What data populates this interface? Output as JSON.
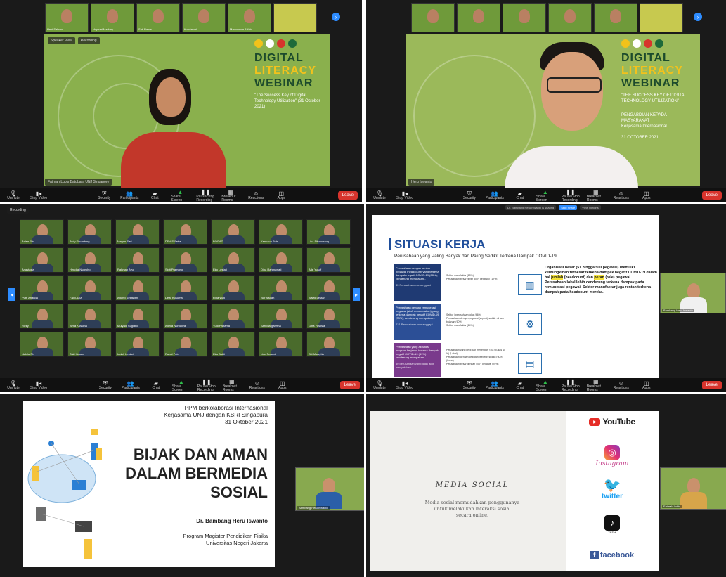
{
  "panel1": {
    "thumbs": [
      "Heni Sabrina",
      "Hapsari Maduny",
      "Sati Ratna",
      "Kurniawati",
      "Mamoonda Alifah"
    ],
    "chip_left": "Speaker View",
    "chip_right": "Recording",
    "slide": {
      "title_1": "DIGITAL",
      "title_2": "LITERACY",
      "title_3": "WEBINAR",
      "tagline": "\"The Success Key of Digital Technology Utilization\" (31 October 2021)"
    },
    "speaker_name": "Fatmah Lubis Batubara UNJ Singapore"
  },
  "panel2": {
    "slide": {
      "title_1": "DIGITAL",
      "title_2": "LITERACY",
      "title_3": "WEBINAR",
      "tagline": "\"THE SUCCESS KEY OF DIGITAL TECHNOLOGY UTILIZATION\"",
      "extra_1": "PENGABDIAN KEPADA MASYARAKAT",
      "extra_2": "Kerjasama Internasional",
      "date": "31 OCTOBER 2021"
    },
    "speaker_name": "Heru Iswanto"
  },
  "toolbar": {
    "mute": "Unmute",
    "video": "Stop Video",
    "security": "Security",
    "participants": "Participants",
    "chat": "Chat",
    "share": "Share Screen",
    "record": "Pause/Stop Recording",
    "breakout": "Breakout Rooms",
    "reactions": "Reactions",
    "apps": "Apps",
    "end": "Leave"
  },
  "panel3": {
    "chip": "Recording",
    "participants": [
      "Anisa Fitri",
      "Jody Sihombing",
      "Megan Sari",
      "DEVIS Setia",
      "BOGAZI",
      "Kencana Putri",
      "Lisa Situmorang",
      "Anastasia",
      "Hendra Nugroho",
      "Rahmah Ayu",
      "Sigit Pramono",
      "Eko Lestari",
      "Dina Rahmawati",
      "Ade Yusuf",
      "Putri Ananda",
      "Fadli Aziz",
      "Agung Setiawan",
      "Dewi Kusuma",
      "Rina Wati",
      "Nur Aisyah",
      "Wiwik Lestari",
      "Rizky",
      "Bima Kusuma",
      "Mulyadi Sugiarto",
      "Adelia Nurhaliza",
      "Yudi Pratama",
      "Sari Margaretha",
      "Gina Yustisia",
      "Nabila Ph",
      "Zaki Hasan",
      "Indah Lestari",
      "Rahul Putri",
      "Eka Sakti",
      "Lina Fenardi",
      "Siti Marsyita"
    ]
  },
  "panel4": {
    "meeting_bar": "Dr. Bambang Heru Iswanto is sharing",
    "stop_share": "Stop Share",
    "more": "View Options",
    "slide": {
      "title": "SITUASI KERJA",
      "subtitle": "Perusahaan yang Paling Banyak dan Paling Sedikit Terkena Dampak COVID-19",
      "box_1": "Perusahaan dengan jumlah pegawai (headcount) yang terkena dampak negatif COVID-19 (68%), cenderung merupakan...",
      "box_1_note": "45 Perusahaan menanggapi",
      "box_2": "Perusahaan dengan remunerasi pegawai (staff remuneration) yang terkena dampak negatif COVID-19 (33%), cenderung merupakan...",
      "box_2_note": "231 Perusahaan menanggapi",
      "box_3": "Perusahaan yang aktivitas program kerjanya terkena dampak negatif COVID-19 (59%) cenderung merupakan...",
      "box_3_note": "40 perusahaan yang tidak aktif menyatakan",
      "list_1": [
        "Sektor manufaktur (18%)",
        "Perusahaan besar (lebih 500+ pegawai) (12%)"
      ],
      "list_2": [
        "Sektor / perusahaan lokal (66%)",
        "Perusahaan dengan pegawai (seperti) sedikit <1 jam bulanan (60%)",
        "Sektor manufaktur (14%)"
      ],
      "list_3": [
        "Perusahaan yang kecil dan menengah <50 (di atas 10 %) (Lokal)",
        "Perusahaan dengan kegiatan (seperti) sedikit (60%) (Lokal)",
        "Perusahaan besar dengan 500+ pegawai (20%)"
      ],
      "summary_1": "Organisasi besar (51 hingga 500 pegawai) memiliki kemungkinan terbesar terkena dampak negatif COVID-19 dalam hal",
      "summary_hl1": "jumlah",
      "summary_2": "(headcount) dan",
      "summary_hl2": "peran",
      "summary_3": "(role) pegawai.",
      "summary_4": "Perusahaan lokal lebih cenderung terkena dampak pada remunerasi pegawai. Sektor manufaktur juga rentan terkena dampak pada headcount mereka."
    },
    "side_speaker": "Bambang Heru Iswanto"
  },
  "panel5": {
    "slide": {
      "meta_1": "PPM berkolaborasi Internasional",
      "meta_2": "Kerjasama UNJ dengan KBRI Singapura",
      "meta_3": "31 Oktober 2021",
      "title_1": "BIJAK DAN AMAN",
      "title_2": "DALAM BERMEDIA",
      "title_3": "SOSIAL",
      "author": "Dr. Bambang Heru Iswanto",
      "program_1": "Program Magister Pendidikan Fisika",
      "program_2": "Universitas Negeri Jakarta"
    },
    "side_speaker": "Bambang Heru Iswanto"
  },
  "panel6": {
    "slide": {
      "title": "MEDIA SOCIAL",
      "desc_1": "Media sosial memudahkan penggunanya",
      "desc_2": "untuk melakukan interaksi sosial",
      "desc_3": "secara online.",
      "youtube": "YouTube",
      "instagram": "Instagram",
      "twitter": "twitter",
      "tiktok": "TikTok",
      "facebook": "facebook"
    },
    "side_speaker": "Fatmah Lubis"
  },
  "colors": {
    "zoom_blue": "#2d8cff",
    "leave_red": "#d8342d",
    "slide_green": "#8ab04d",
    "situasi_blue": "#1f4e9b"
  }
}
